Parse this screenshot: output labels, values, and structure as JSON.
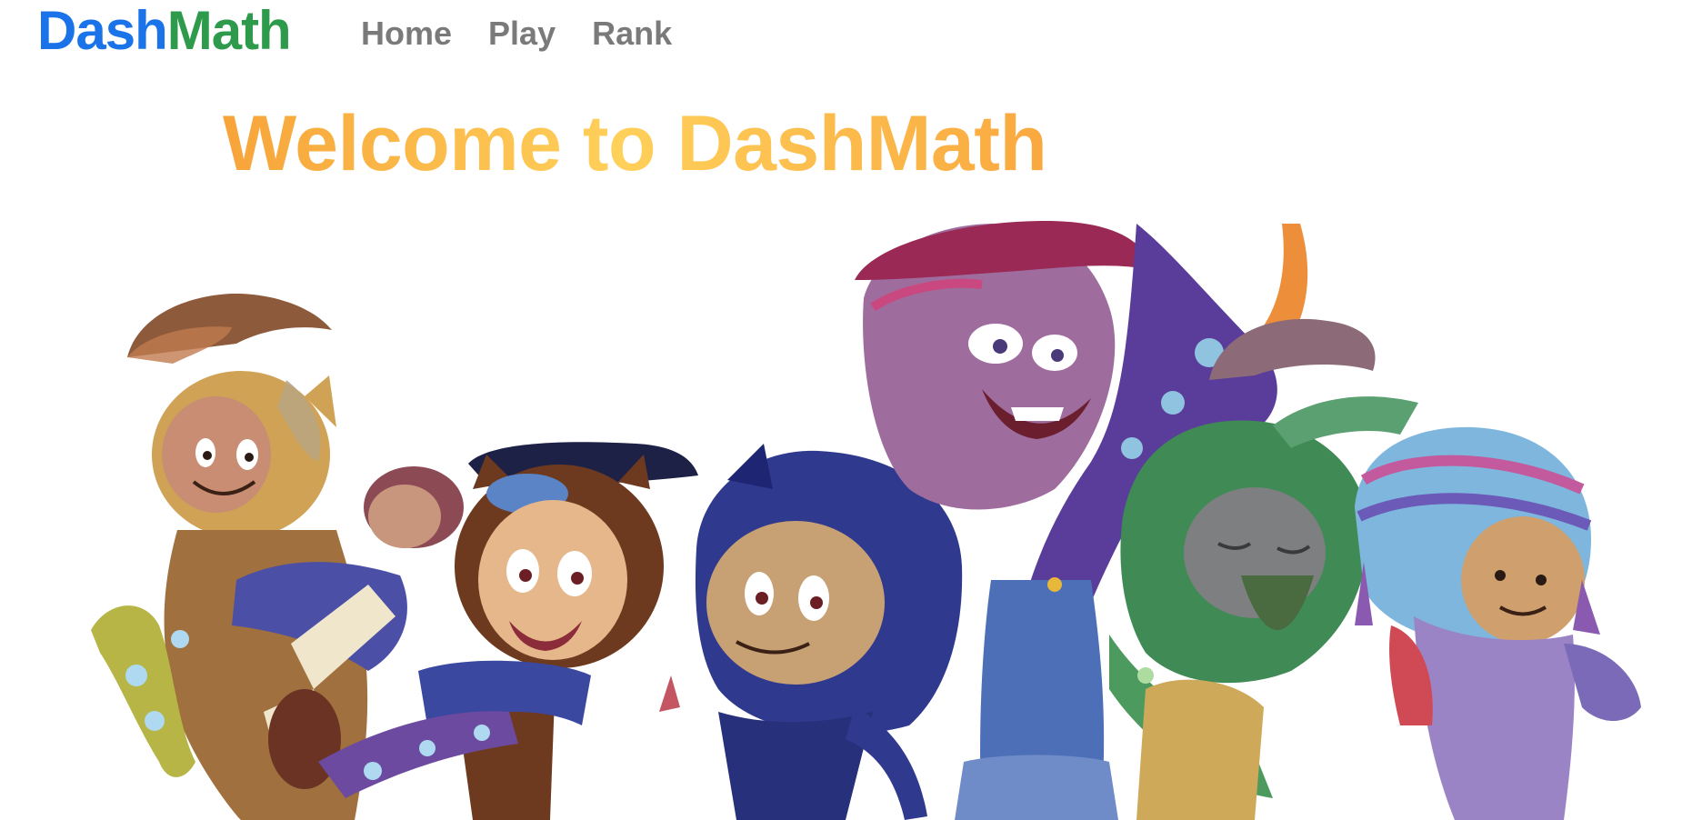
{
  "brand": {
    "part1": "Dash",
    "part2": "Math",
    "color1": "#1a73e8",
    "color2": "#2e9b4c"
  },
  "nav": {
    "items": [
      {
        "label": "Home"
      },
      {
        "label": "Play"
      },
      {
        "label": "Rank"
      }
    ]
  },
  "main": {
    "welcome_title": "Welcome to DashMath",
    "title_gradient": [
      "#f7a43a",
      "#ffd05a",
      "#f9a83f"
    ]
  },
  "hero": {
    "description": "cartoon octocat character mascots group",
    "character_icons": [
      "pompadour-cat-icon",
      "aviator-cat-icon",
      "ninja-cat-icon",
      "bandana-octopus-icon",
      "bearded-creature-icon",
      "winter-hat-cat-icon"
    ]
  }
}
